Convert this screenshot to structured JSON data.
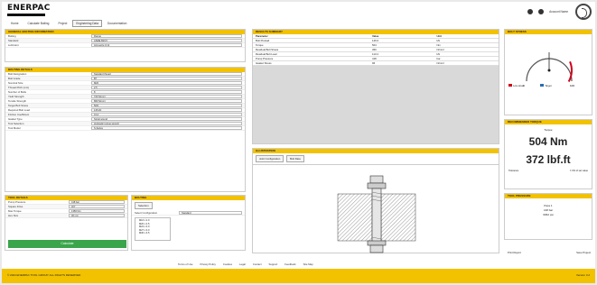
{
  "header": {
    "brand": "ENERPAC",
    "user_label": "Account Name",
    "tabs": [
      "Home",
      "Calculate Bolting",
      "Project",
      "Engineering Data",
      "Documentation"
    ],
    "active_tab": 3
  },
  "general": {
    "title": "GENERAL BOLTING INFORMATION",
    "rows": [
      {
        "label": "Bolting",
        "value": "Flange"
      },
      {
        "label": "Standard",
        "value": "ASME B16.5"
      },
      {
        "label": "Lubricant",
        "value": "Anti-seize 0.12"
      }
    ]
  },
  "bolt_details": {
    "title": "BOLTING DETAILS",
    "rows": [
      {
        "label": "Bolt Designation",
        "value": "Standard thread"
      },
      {
        "label": "Bolt Grade",
        "value": "B7"
      },
      {
        "label": "Nominal Size",
        "value": "M20"
      },
      {
        "label": "Thread Pitch (mm)",
        "value": "2.5"
      },
      {
        "label": "Number of Bolts",
        "value": "8"
      },
      {
        "label": "Yield Strength",
        "value": "720 N/mm²"
      },
      {
        "label": "Tensile Strength",
        "value": "860 N/mm²"
      },
      {
        "label": "Target Bolt Stress",
        "value": "50%"
      },
      {
        "label": "Required Bolt Load",
        "value": "126 kN"
      },
      {
        "label": "Friction Coefficient",
        "value": "0.12"
      },
      {
        "label": "Gasket Type",
        "value": "Spiral wound"
      },
      {
        "label": "Tool Selection",
        "value": "Hydraulic torque wrench"
      },
      {
        "label": "Tool Model",
        "value": "S-Series"
      }
    ]
  },
  "tool_details": {
    "title": "TOOL DETAILS",
    "rows": [
      {
        "label": "Pump Pressure",
        "value": "418 bar"
      },
      {
        "label": "Square Drive",
        "value": "3/4\""
      },
      {
        "label": "Max Torque",
        "value": "1350 Nm"
      },
      {
        "label": "Hex Size",
        "value": "30 mm"
      }
    ],
    "calculate_label": "Calculate"
  },
  "selection": {
    "title": "BOLTING",
    "tab": "Selection",
    "field_label": "Select Configuration",
    "field_value": "Standard",
    "items": [
      "M16 x 2.0",
      "M20 x 2.5",
      "M24 x 3.0",
      "M27 x 3.0",
      "M30 x 3.5"
    ]
  },
  "results": {
    "title": "RESULTS SUMMARY",
    "rows": [
      {
        "a": "Parameter",
        "b": "Value",
        "c": "Unit"
      },
      {
        "a": "Bolt Preload",
        "b": "126.0",
        "c": "kN"
      },
      {
        "a": "Torque",
        "b": "504",
        "c": "Nm"
      },
      {
        "a": "Residual Bolt Stress",
        "b": "360",
        "c": "N/mm²"
      },
      {
        "a": "Residual Bolt Load",
        "b": "113.4",
        "c": "kN"
      },
      {
        "a": "Pump Pressure",
        "b": "418",
        "c": "bar"
      },
      {
        "a": "Gasket Stress",
        "b": "96",
        "c": "N/mm²"
      }
    ]
  },
  "illustration": {
    "title": "ILLUSTRATION",
    "tabs": [
      "Joint Configuration",
      "Bolt Data"
    ]
  },
  "gauge": {
    "title": "BOLT STRESS",
    "ticks": [
      "0",
      "100"
    ],
    "value_pct": 50,
    "legend_low": "Low stress",
    "legend_high": "Target",
    "low_color": "#d0021b",
    "high_color": "#2b6cb0"
  },
  "torque": {
    "title": "RECOMMENDED TORQUE",
    "label": "Torque",
    "nm": "504 Nm",
    "lbft": "372 lbf.ft",
    "note_label": "Tolerance",
    "note_value": "± 3% of set value"
  },
  "tool_out": {
    "title": "TOOL PRESSURE",
    "lines": [
      "Pass 1",
      "418 bar",
      "6062 psi"
    ]
  },
  "side_links": [
    "Print Report",
    "Save Project"
  ],
  "bottom_links": [
    "Terms of Use",
    "Privacy Policy",
    "Cookies",
    "Legal",
    "Contact",
    "Support",
    "Feedback",
    "Site Map"
  ],
  "footer": {
    "left": "© 2024 ENERPAC TOOL GROUP. ALL RIGHTS RESERVED",
    "right": "Version 3.2"
  },
  "colors": {
    "accent": "#f2c200",
    "button": "#3aa54a"
  }
}
